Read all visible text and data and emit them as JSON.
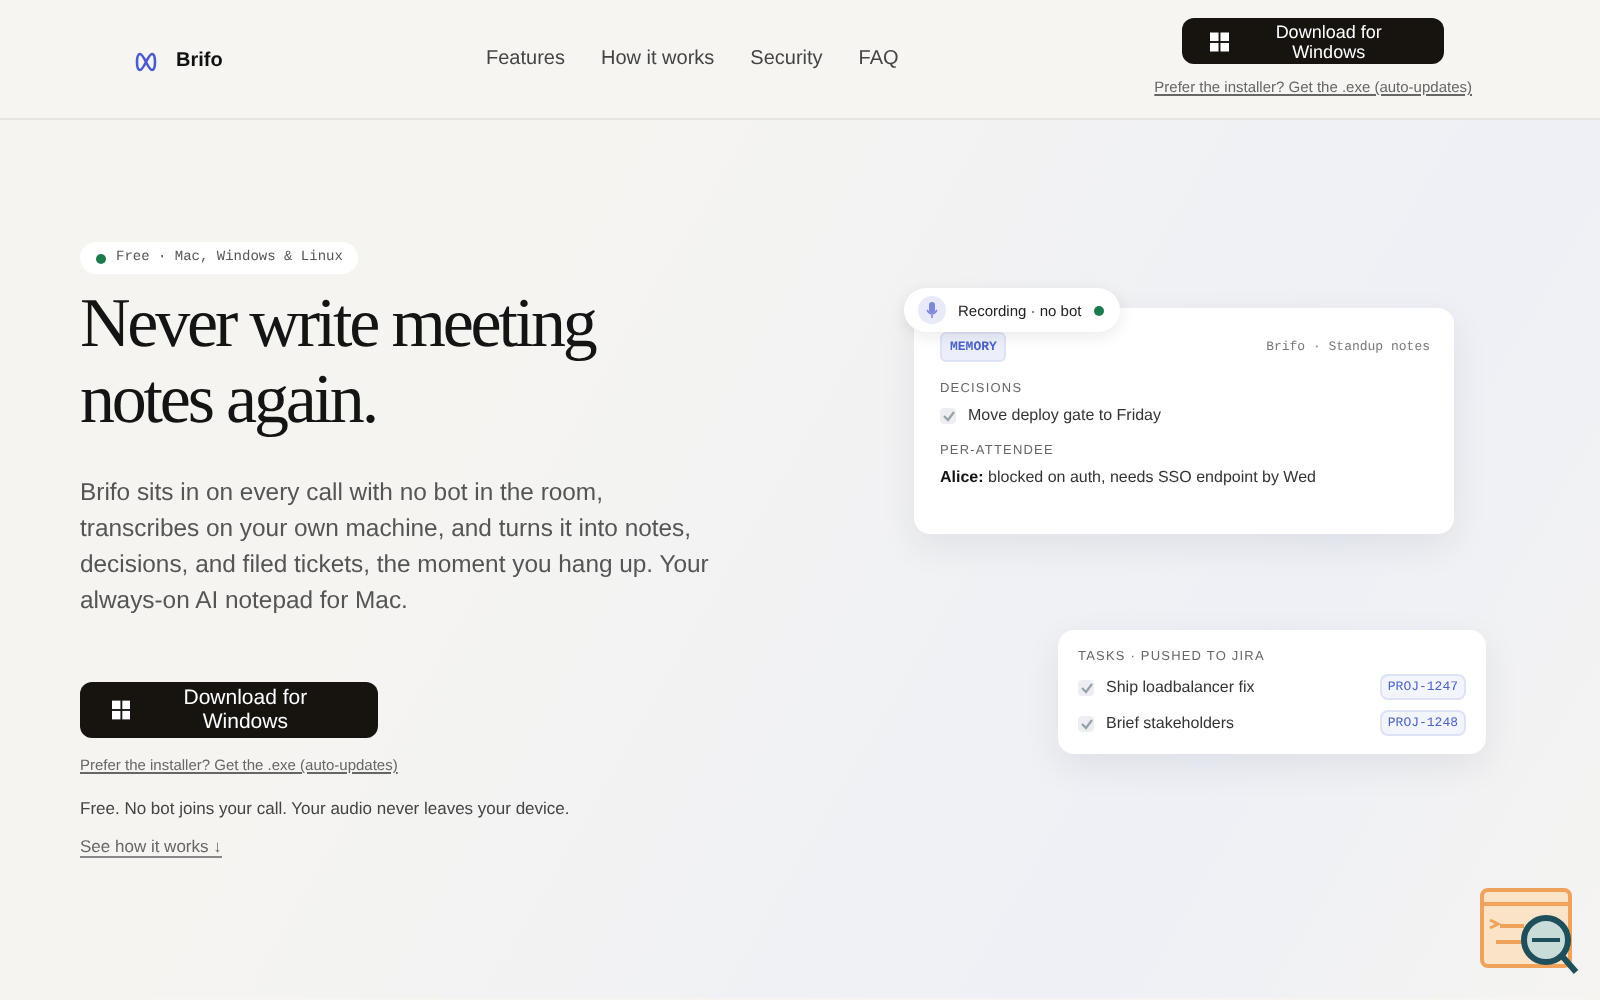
{
  "header": {
    "brand": "Brifo",
    "nav": [
      "Features",
      "How it works",
      "Security",
      "FAQ"
    ],
    "cta": "Download for Windows",
    "cta_note": "Prefer the installer? Get the .exe (auto-updates)"
  },
  "hero": {
    "badge": "Free · Mac, Windows & Linux",
    "title": "Never write meeting notes again.",
    "lead": "Brifo sits in on every call with no bot in the room, transcribes on your own machine, and turns it into notes, decisions, and filed tickets, the moment you hang up. Your always-on AI notepad for Mac.",
    "cta": "Download for Windows",
    "cta_note": "Prefer the installer? Get the .exe (auto-updates)",
    "fine_print": "Free. No bot joins your call. Your audio never leaves your device.",
    "see_how": "See how it works",
    "see_how_arrow": "↓"
  },
  "notes_card": {
    "recording": "Recording · no bot",
    "tag": "MEMORY",
    "source": "Brifo · Standup notes",
    "sections": [
      {
        "kind": "checklist",
        "heading": "DECISIONS",
        "items": [
          {
            "text": "Move deploy gate to Friday",
            "checked": true
          }
        ]
      },
      {
        "kind": "attendees",
        "heading": "PER-ATTENDEE",
        "items": [
          {
            "text": "**Alice:** blocked on auth, needs SSO endpoint by Wed"
          }
        ]
      }
    ]
  },
  "tasks_card": {
    "heading": "TASKS · PUSHED TO JIRA",
    "tasks": [
      {
        "text": "Ship loadbalancer fix",
        "ticket": "PROJ-1247",
        "checked": true
      },
      {
        "text": "Brief stakeholders",
        "ticket": "PROJ-1248",
        "checked": true
      }
    ]
  }
}
